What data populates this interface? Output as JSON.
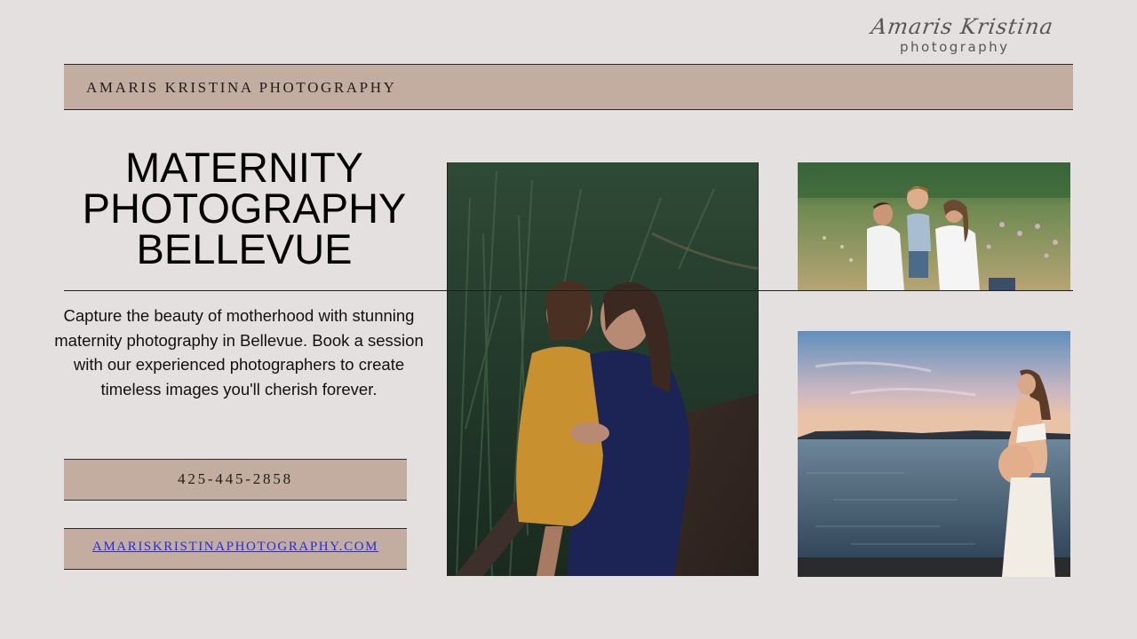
{
  "logo": {
    "script": "Amaris Kristina",
    "sub": "photography"
  },
  "header": {
    "title": "AMARIS KRISTINA PHOTOGRAPHY"
  },
  "main": {
    "title_lines": [
      "MATERNITY",
      "PHOTOGRAPHY",
      "BELLEVUE"
    ],
    "description": "Capture the beauty of motherhood with stunning maternity photography in Bellevue. Book a session with our experienced photographers to create timeless images you'll cherish forever."
  },
  "contact": {
    "phone": "425-445-2858",
    "website": "AMARISKRISTINAPHOTOGRAPHY.COM"
  },
  "photos": {
    "main": "mother-and-daughter-photo",
    "family": "family-meadow-photo",
    "beach": "maternity-beach-photo"
  },
  "colors": {
    "background": "#e3e0df",
    "band": "#c2ada0",
    "link": "#2a2ae0"
  }
}
